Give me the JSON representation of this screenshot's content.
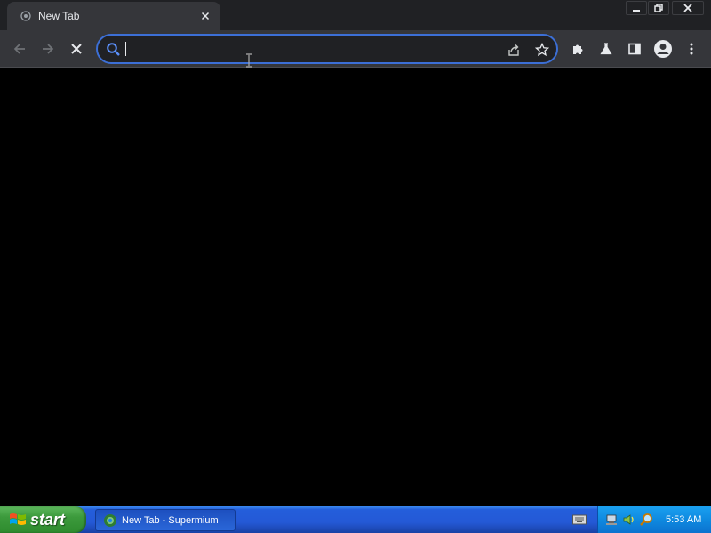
{
  "window": {
    "tab_title": "New Tab"
  },
  "omnibox": {
    "value": "",
    "placeholder": ""
  },
  "icons": {
    "tab_favicon": "new-tab-favicon",
    "tab_close": "close-icon",
    "back": "arrow-left-icon",
    "forward": "arrow-right-icon",
    "stop": "stop-x-icon",
    "search": "search-icon",
    "share": "share-icon",
    "bookmark": "star-icon",
    "extensions": "puzzle-icon",
    "labs": "flask-icon",
    "side_panel": "side-panel-icon",
    "profile": "avatar-icon",
    "menu": "kebab-menu-icon"
  },
  "taskbar": {
    "start_label": "start",
    "task_label": "New Tab - Supermium",
    "clock": "5:53 AM"
  },
  "colors": {
    "omnibox_focus": "#3c6fd6",
    "toolbar_bg": "#35363a",
    "titlebar_bg": "#202124",
    "taskbar_blue": "#245edb",
    "start_green": "#3c9a3c",
    "tray_blue": "#0f8ae0"
  }
}
